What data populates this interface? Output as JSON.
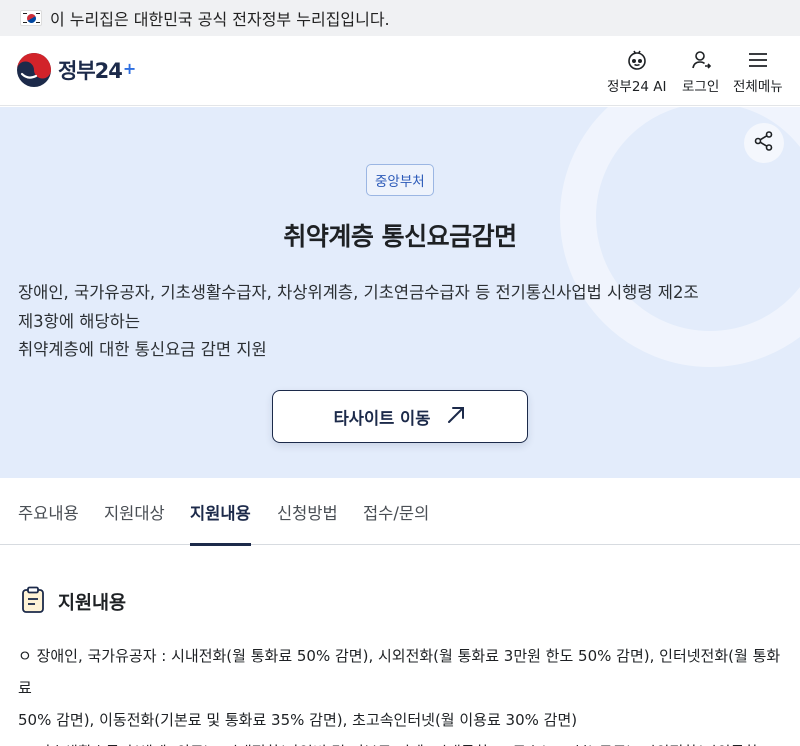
{
  "gov_banner": {
    "text": "이 누리집은 대한민국 공식 전자정부 누리집입니다."
  },
  "header": {
    "logo_text": "정부24",
    "ai_label": "정부24 AI",
    "login_label": "로그인",
    "menu_label": "전체메뉴"
  },
  "hero": {
    "badge": "중앙부처",
    "title": "취약계층 통신요금감면",
    "desc_lines": [
      "장애인, 국가유공자, 기초생활수급자, 차상위계층, 기초연금수급자 등 전기통신사업법 시행령 제2조",
      "제3항에 해당하는",
      "취약계층에 대한 통신요금 감면 지원"
    ],
    "cta_label": "타사이트 이동"
  },
  "tabs": [
    {
      "label": "주요내용",
      "active": false
    },
    {
      "label": "지원대상",
      "active": false
    },
    {
      "label": "지원내용",
      "active": true
    },
    {
      "label": "신청방법",
      "active": false
    },
    {
      "label": "접수/문의",
      "active": false
    }
  ],
  "section": {
    "title": "지원내용",
    "lines": [
      "ㅇ 장애인, 국가유공자 : 시내전화(월 통화료 50% 감면), 시외전화(월 통화료 3만원 한도 50% 감면), 인터넷전화(월 통화료",
      "50% 감면), 이동전화(기본료 및 통화료 35% 감면), 초고속인터넷(월 이용료 30% 감면)",
      "ㅇ 기초생활수급자(생계, 의료) : 시내전화(가입비 및 기본료 면제, 시내통화 75도수(225분) 무료), 시외전화(시외통화"
    ]
  },
  "colors": {
    "primary": "#1c2a4a",
    "hero_bg": "#e3ecfb",
    "badge_text": "#2c5ab8"
  }
}
